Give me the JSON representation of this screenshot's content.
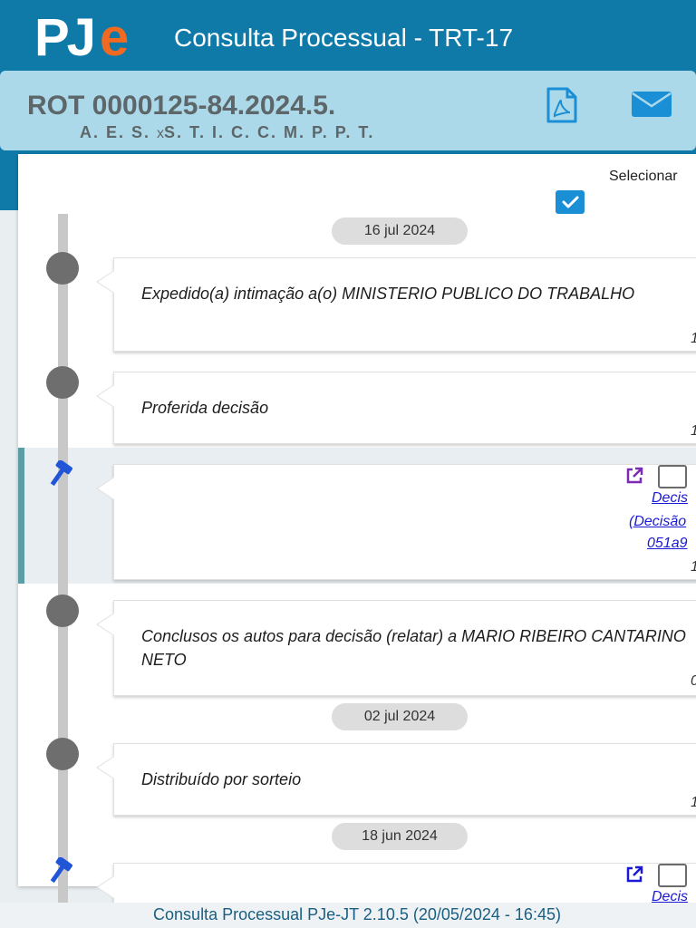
{
  "header": {
    "logo_pj": "PJ",
    "logo_e": "e",
    "title": "Consulta Processual - TRT-17",
    "brand_color": "#0f7aa8",
    "accent_color": "#f26a21"
  },
  "process": {
    "number": "ROT 0000125-84.2024.5.",
    "party_a": "A. E. S.",
    "separator": "x",
    "party_b": "S. T. I. C. C. M. P. P. T.",
    "pdf_icon": "pdf-file-icon",
    "mail_icon": "envelope-icon"
  },
  "selection": {
    "label": "Selecionar",
    "checked": true
  },
  "timeline": {
    "dates": [
      "16 jul 2024",
      "02 jul 2024",
      "18 jun 2024"
    ],
    "events": [
      {
        "text": "Expedido(a) intimação a(o) MINISTERIO PUBLICO DO TRABALHO",
        "time": "1"
      },
      {
        "text": "Proferida decisão",
        "time": "1"
      },
      {
        "doc_link_1": "Decis",
        "doc_link_2": "(Decisão",
        "doc_link_3": "051a9",
        "time": "1"
      },
      {
        "text": "Conclusos os autos para decisão (relatar) a MARIO RIBEIRO CANTARINO NETO",
        "time": "0"
      },
      {
        "text": "Distribuído por sorteio",
        "time": "1"
      },
      {
        "doc_link_1": "Decis"
      }
    ]
  },
  "footer": {
    "text": "Consulta Processual PJe-JT 2.10.5 (20/05/2024 - 16:45)"
  }
}
